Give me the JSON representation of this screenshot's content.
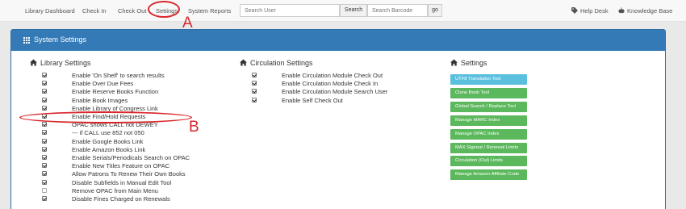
{
  "nav": {
    "links": [
      "Library Dashboard",
      "Check In",
      "Check Out",
      "Settings",
      "System Reports"
    ],
    "search_user_placeholder": "Search User",
    "search_button": "Search",
    "search_barcode_placeholder": "Search Barcode",
    "go_button": "go",
    "help_desk": "Help Desk",
    "knowledge_base": "Knowledge Base"
  },
  "annotations": {
    "a": "A",
    "b": "B",
    "color": "#d9262b"
  },
  "panel": {
    "title": "System Settings",
    "header_color": "#337ab7"
  },
  "library_settings": {
    "title": "Library Settings",
    "items": [
      {
        "label": "Enable 'On Shelf' to search results",
        "checked": true
      },
      {
        "label": "Enable Over Due Fees",
        "checked": true
      },
      {
        "label": "Enable Reserve Books Function",
        "checked": true
      },
      {
        "label": "Enable Book Images",
        "checked": true
      },
      {
        "label": "Enable Library of Congress Link",
        "checked": true
      },
      {
        "label": "Enable Find/Hold Requests",
        "checked": true
      },
      {
        "label": "OPAC shows CALL not DEWEY",
        "checked": true
      },
      {
        "label": "--- if CALL use 852 not 050",
        "checked": true
      },
      {
        "label": "Enable Google Books Link",
        "checked": true
      },
      {
        "label": "Enable Amazon Books Link",
        "checked": true
      },
      {
        "label": "Enable Serials/Periodicals Search on OPAC",
        "checked": true
      },
      {
        "label": "Enable New Titles Feature on OPAC",
        "checked": true
      },
      {
        "label": "Allow Patrons To Renew Their Own Books",
        "checked": true
      },
      {
        "label": "Disable Subfields in Manual Edit Tool",
        "checked": true
      },
      {
        "label": "Remove OPAC from Main Menu",
        "checked": false
      },
      {
        "label": "Disable Fines Charged on Renewals",
        "checked": true
      }
    ]
  },
  "circulation_settings": {
    "title": "Circulation Settings",
    "items": [
      {
        "label": "Enable Circulation Module Check Out",
        "checked": true
      },
      {
        "label": "Enable Circulation Module Check In",
        "checked": true
      },
      {
        "label": "Enable Circulation Module Search User",
        "checked": true
      },
      {
        "label": "Enable Self Check Out",
        "checked": true
      }
    ]
  },
  "settings_tools": {
    "title": "Settings",
    "buttons": [
      {
        "label": "UTF8 Translation Tool",
        "style": "info"
      },
      {
        "label": "Clone Book Tool",
        "style": "success"
      },
      {
        "label": "Global Search / Replace Tool",
        "style": "success"
      },
      {
        "label": "Manage MARC Index",
        "style": "success"
      },
      {
        "label": "Manage OPAC Index",
        "style": "success"
      },
      {
        "label": "MAX Signout / Renewal Limits",
        "style": "success"
      },
      {
        "label": "Circulation (Out) Limits",
        "style": "success"
      },
      {
        "label": "Manage Amazon Affiliate Code",
        "style": "success"
      }
    ]
  }
}
